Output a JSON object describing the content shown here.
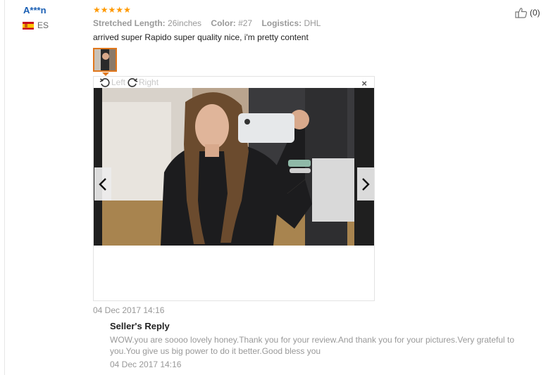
{
  "reviewer": {
    "name": "A***n",
    "country": "ES"
  },
  "rating": {
    "stars": 5,
    "color": "#ff9900"
  },
  "attributes": [
    {
      "key": "Stretched Length:",
      "value": "26inches"
    },
    {
      "key": "Color:",
      "value": "#27"
    },
    {
      "key": "Logistics:",
      "value": "DHL"
    }
  ],
  "review": {
    "text": "arrived super Rapido super quality nice, i'm pretty content",
    "date": "04 Dec 2017 14:16"
  },
  "helpful": {
    "count": "(0)"
  },
  "viewer": {
    "rotate_left": "Left",
    "rotate_right": "Right",
    "close": "×"
  },
  "seller_reply": {
    "title": "Seller's Reply",
    "text": "WOW.you are soooo lovely honey.Thank you for your review.And thank you for your pictures.Very grateful to you.You give us big power to do it better.Good bless you",
    "date": "04 Dec 2017 14:16"
  },
  "colors": {
    "link": "#1a5fb4",
    "accent": "#e0771c",
    "muted": "#999999"
  }
}
